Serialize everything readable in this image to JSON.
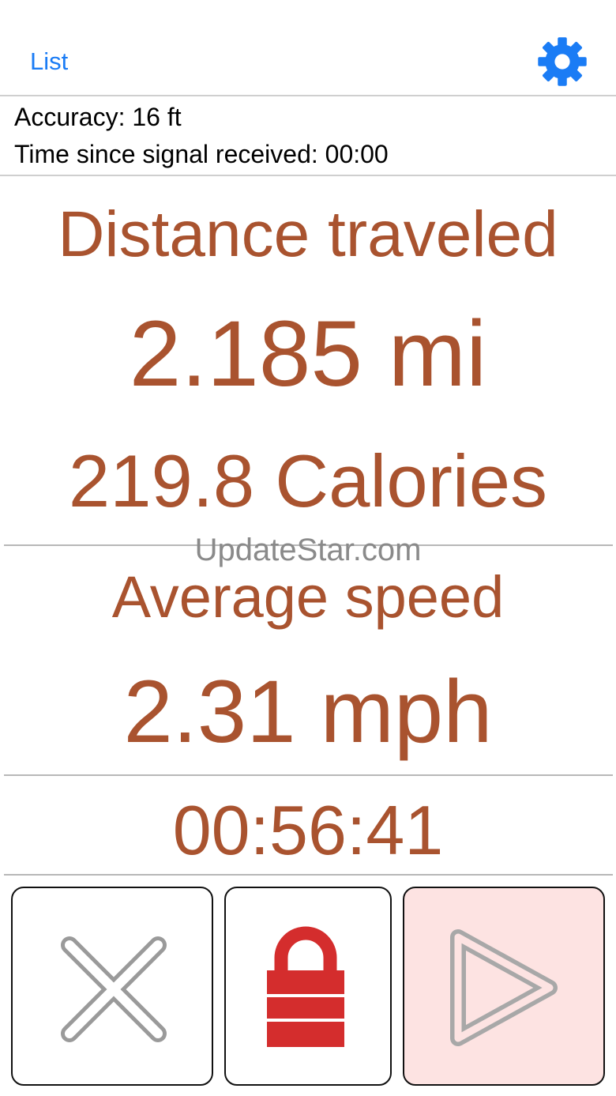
{
  "nav": {
    "list_label": "List",
    "settings_icon": "gear-icon",
    "accent_color": "#1a7cf5"
  },
  "status": {
    "accuracy": "Accuracy: 16 ft",
    "signal_time": "Time since signal received: 00:00"
  },
  "distance": {
    "label": "Distance traveled",
    "value": "2.185 mi",
    "calories": "219.8 Calories"
  },
  "watermark": "UpdateStar.com",
  "speed": {
    "label": "Average speed",
    "value": "2.31 mph"
  },
  "elapsed": "00:56:41",
  "controls": [
    {
      "icon": "cancel-x-icon"
    },
    {
      "icon": "lock-icon",
      "color": "#d42d2d"
    },
    {
      "icon": "play-icon"
    }
  ],
  "text_color": "#a9532f"
}
